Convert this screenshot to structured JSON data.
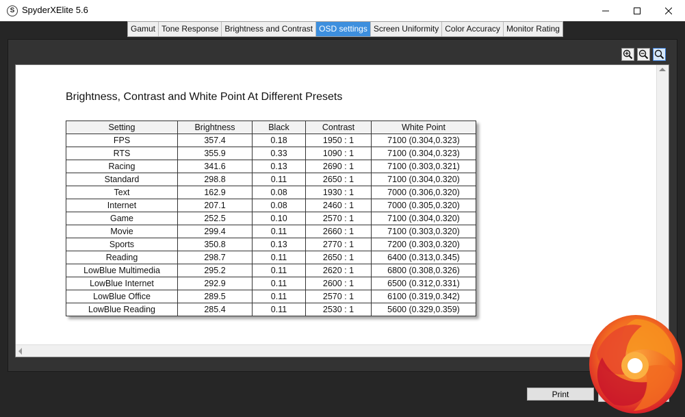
{
  "window": {
    "title": "SpyderXElite 5.6",
    "icon_letter": "S"
  },
  "tabs": [
    {
      "label": "Gamut",
      "active": false
    },
    {
      "label": "Tone Response",
      "active": false
    },
    {
      "label": "Brightness and Contrast",
      "active": false
    },
    {
      "label": "OSD settings",
      "active": true
    },
    {
      "label": "Screen Uniformity",
      "active": false
    },
    {
      "label": "Color Accuracy",
      "active": false
    },
    {
      "label": "Monitor Rating",
      "active": false
    }
  ],
  "zoom_controls": [
    "zoom-in-icon",
    "zoom-out-icon",
    "zoom-fit-icon"
  ],
  "report": {
    "title": "Brightness, Contrast and White Point At Different Presets",
    "columns": [
      "Setting",
      "Brightness",
      "Black",
      "Contrast",
      "White Point"
    ],
    "rows": [
      [
        "FPS",
        "357.4",
        "0.18",
        "1950 : 1",
        "7100 (0.304,0.323)"
      ],
      [
        "RTS",
        "355.9",
        "0.33",
        "1090 : 1",
        "7100 (0.304,0.323)"
      ],
      [
        "Racing",
        "341.6",
        "0.13",
        "2690 : 1",
        "7100 (0.303,0.321)"
      ],
      [
        "Standard",
        "298.8",
        "0.11",
        "2650 : 1",
        "7100 (0.304,0.320)"
      ],
      [
        "Text",
        "162.9",
        "0.08",
        "1930 : 1",
        "7000 (0.306,0.320)"
      ],
      [
        "Internet",
        "207.1",
        "0.08",
        "2460 : 1",
        "7000 (0.305,0.320)"
      ],
      [
        "Game",
        "252.5",
        "0.10",
        "2570 : 1",
        "7100 (0.304,0.320)"
      ],
      [
        "Movie",
        "299.4",
        "0.11",
        "2660 : 1",
        "7100 (0.303,0.320)"
      ],
      [
        "Sports",
        "350.8",
        "0.13",
        "2770 : 1",
        "7200 (0.303,0.320)"
      ],
      [
        "Reading",
        "298.7",
        "0.11",
        "2650 : 1",
        "6400 (0.313,0.345)"
      ],
      [
        "LowBlue Multimedia",
        "295.2",
        "0.11",
        "2620 : 1",
        "6800 (0.308,0.326)"
      ],
      [
        "LowBlue Internet",
        "292.9",
        "0.11",
        "2600 : 1",
        "6500 (0.312,0.331)"
      ],
      [
        "LowBlue Office",
        "289.5",
        "0.11",
        "2570 : 1",
        "6100 (0.319,0.342)"
      ],
      [
        "LowBlue Reading",
        "285.4",
        "0.11",
        "2530 : 1",
        "5600 (0.329,0.359)"
      ]
    ]
  },
  "footer": {
    "print_label": "Print"
  },
  "colors": {
    "tab_active": "#3d8fde",
    "app_background": "#262626",
    "logo_orange": "#f26b21",
    "logo_red": "#d81e2a"
  }
}
